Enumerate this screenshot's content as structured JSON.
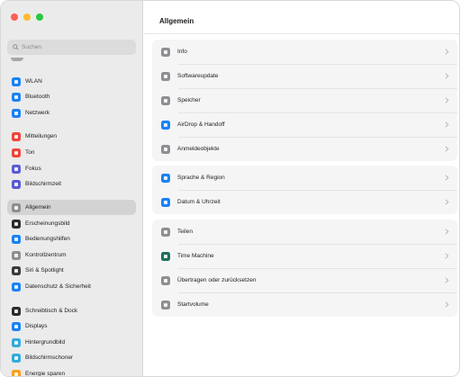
{
  "search": {
    "placeholder": "Suchen"
  },
  "sidebar": {
    "items": [
      {
        "label": "WLAN",
        "icon": "wifi-icon",
        "color": "#1a82f7"
      },
      {
        "label": "Bluetooth",
        "icon": "bluetooth-icon",
        "color": "#1a82f7"
      },
      {
        "label": "Netzwerk",
        "icon": "network-icon",
        "color": "#1a82f7"
      },
      {
        "label": "Mitteilungen",
        "icon": "notifications-icon",
        "color": "#f0443a"
      },
      {
        "label": "Ton",
        "icon": "sound-icon",
        "color": "#f0443a"
      },
      {
        "label": "Fokus",
        "icon": "focus-icon",
        "color": "#5b5bd6"
      },
      {
        "label": "Bildschirmzeit",
        "icon": "screentime-icon",
        "color": "#5b5bd6"
      },
      {
        "label": "Allgemein",
        "icon": "gear-icon",
        "color": "#8e8e93",
        "selected": true
      },
      {
        "label": "Erscheinungsbild",
        "icon": "appearance-icon",
        "color": "#2b2b2b"
      },
      {
        "label": "Bedienungshilfen",
        "icon": "accessibility-icon",
        "color": "#1a82f7"
      },
      {
        "label": "Kontrollzentrum",
        "icon": "control-center-icon",
        "color": "#8e8e93"
      },
      {
        "label": "Siri & Spotlight",
        "icon": "siri-icon",
        "color": "#3a3a3c"
      },
      {
        "label": "Datenschutz & Sicherheit",
        "icon": "privacy-hand-icon",
        "color": "#1a82f7"
      },
      {
        "label": "Schreibtisch & Dock",
        "icon": "dock-icon",
        "color": "#2b2b2b"
      },
      {
        "label": "Displays",
        "icon": "display-icon",
        "color": "#1a82f7"
      },
      {
        "label": "Hintergrundbild",
        "icon": "wallpaper-icon",
        "color": "#34aadc"
      },
      {
        "label": "Bildschirmschoner",
        "icon": "screensaver-icon",
        "color": "#34aadc"
      },
      {
        "label": "Energie sparen",
        "icon": "energy-icon",
        "color": "#f7a21b"
      }
    ]
  },
  "main": {
    "title": "Allgemein",
    "groups": [
      [
        {
          "label": "Info",
          "icon": "info-icon",
          "color": "#8e8e93"
        },
        {
          "label": "Softwareupdate",
          "icon": "software-update-icon",
          "color": "#8e8e93"
        },
        {
          "label": "Speicher",
          "icon": "storage-icon",
          "color": "#8e8e93"
        },
        {
          "label": "AirDrop & Handoff",
          "icon": "airdrop-icon",
          "color": "#1a82f7"
        },
        {
          "label": "Anmeldeobjekte",
          "icon": "login-items-icon",
          "color": "#8e8e93"
        }
      ],
      [
        {
          "label": "Sprache & Region",
          "icon": "language-icon",
          "color": "#1a82f7"
        },
        {
          "label": "Datum & Uhrzeit",
          "icon": "clock-icon",
          "color": "#1a82f7"
        }
      ],
      [
        {
          "label": "Teilen",
          "icon": "sharing-icon",
          "color": "#8e8e93"
        },
        {
          "label": "Time Machine",
          "icon": "time-machine-icon",
          "color": "#1f6f5c"
        },
        {
          "label": "Übertragen oder zurücksetzen",
          "icon": "reset-icon",
          "color": "#8e8e93"
        },
        {
          "label": "Startvolume",
          "icon": "startup-disk-icon",
          "color": "#8e8e93"
        }
      ]
    ]
  }
}
